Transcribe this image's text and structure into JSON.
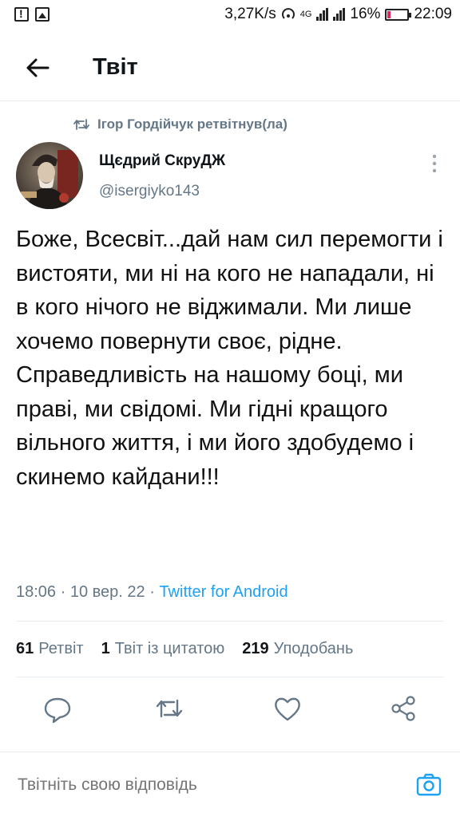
{
  "status_bar": {
    "speed": "3,27K/s",
    "network": "4G",
    "battery": "16%",
    "time": "22:09",
    "icons": [
      "alert-icon",
      "image-icon",
      "hotspot-icon",
      "signal-icon",
      "battery-icon"
    ]
  },
  "header": {
    "title": "Твіт",
    "back_icon": "arrow-left-icon"
  },
  "tweet": {
    "retweeted_by": "Ігор Гордійчук ретвітнув(ла)",
    "author_name": "Щєдрий СкруДЖ",
    "author_handle": "@isergiyko143",
    "text": "Боже, Всесвіт...дай нам сил перемогти і вистояти, ми ні на кого не нападали, ні в кого нічого не віджимали. Ми лише хочемо повернути своє, рідне. Справедливість на нашому боці, ми праві, ми свідомі. Ми гідні кращого вільного життя, і ми його здобудемо і скинемо кайдани!!!",
    "time": "18:06",
    "date": "10 вер. 22",
    "source": "Twitter for Android"
  },
  "stats": {
    "retweets_count": "61",
    "retweets_label": "Ретвіт",
    "quotes_count": "1",
    "quotes_label": "Твіт із цитатою",
    "likes_count": "219",
    "likes_label": "Уподобань"
  },
  "reply": {
    "placeholder": "Твітніть свою відповідь"
  },
  "colors": {
    "accent": "#1da1f2",
    "muted": "#657786",
    "divider": "#e6ecf0"
  }
}
